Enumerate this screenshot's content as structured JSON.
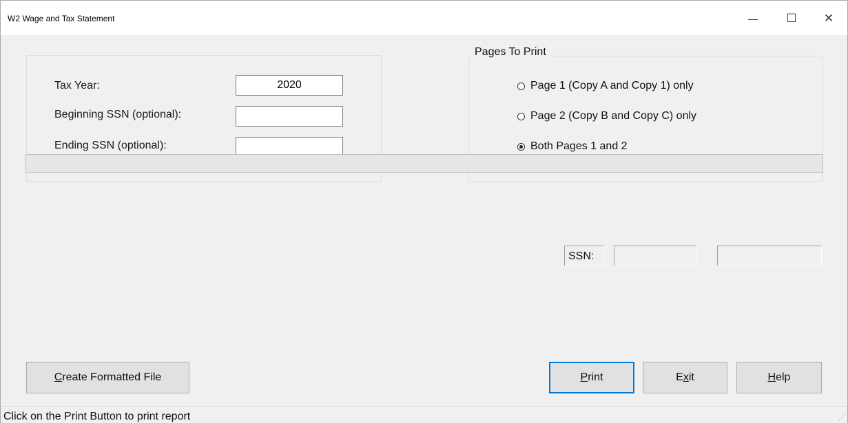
{
  "window": {
    "title": "W2 Wage and Tax Statement",
    "minimize_symbol": "—",
    "maximize_symbol": "☐",
    "close_symbol": "✕"
  },
  "fields": {
    "tax_year_label": "Tax Year:",
    "tax_year_value": "2020",
    "beginning_ssn_label": "Beginning SSN (optional):",
    "beginning_ssn_value": "",
    "ending_ssn_label": "Ending SSN (optional):",
    "ending_ssn_value": ""
  },
  "pages_to_print": {
    "legend": "Pages To Print",
    "options": [
      {
        "label": "Page 1 (Copy A and Copy 1) only",
        "selected": false
      },
      {
        "label": "Page 2 (Copy B and Copy C) only",
        "selected": false
      },
      {
        "label": "Both Pages 1 and 2",
        "selected": true
      }
    ]
  },
  "progress": {
    "value": 0
  },
  "ssn_display": {
    "label": "SSN:",
    "value1": "",
    "value2": ""
  },
  "buttons": {
    "create_first": "C",
    "create_rest": "reate Formatted File",
    "print_first": "P",
    "print_rest": "rint",
    "exit_first": "E",
    "exit_underlined": "x",
    "exit_rest": "it",
    "help_first": "H",
    "help_rest": "elp"
  },
  "status": {
    "text": "Click on the Print Button to print report"
  },
  "icons": {
    "minimize": "minimize-icon",
    "maximize": "maximize-icon",
    "close": "close-icon",
    "grip": "size-grip-icon"
  }
}
